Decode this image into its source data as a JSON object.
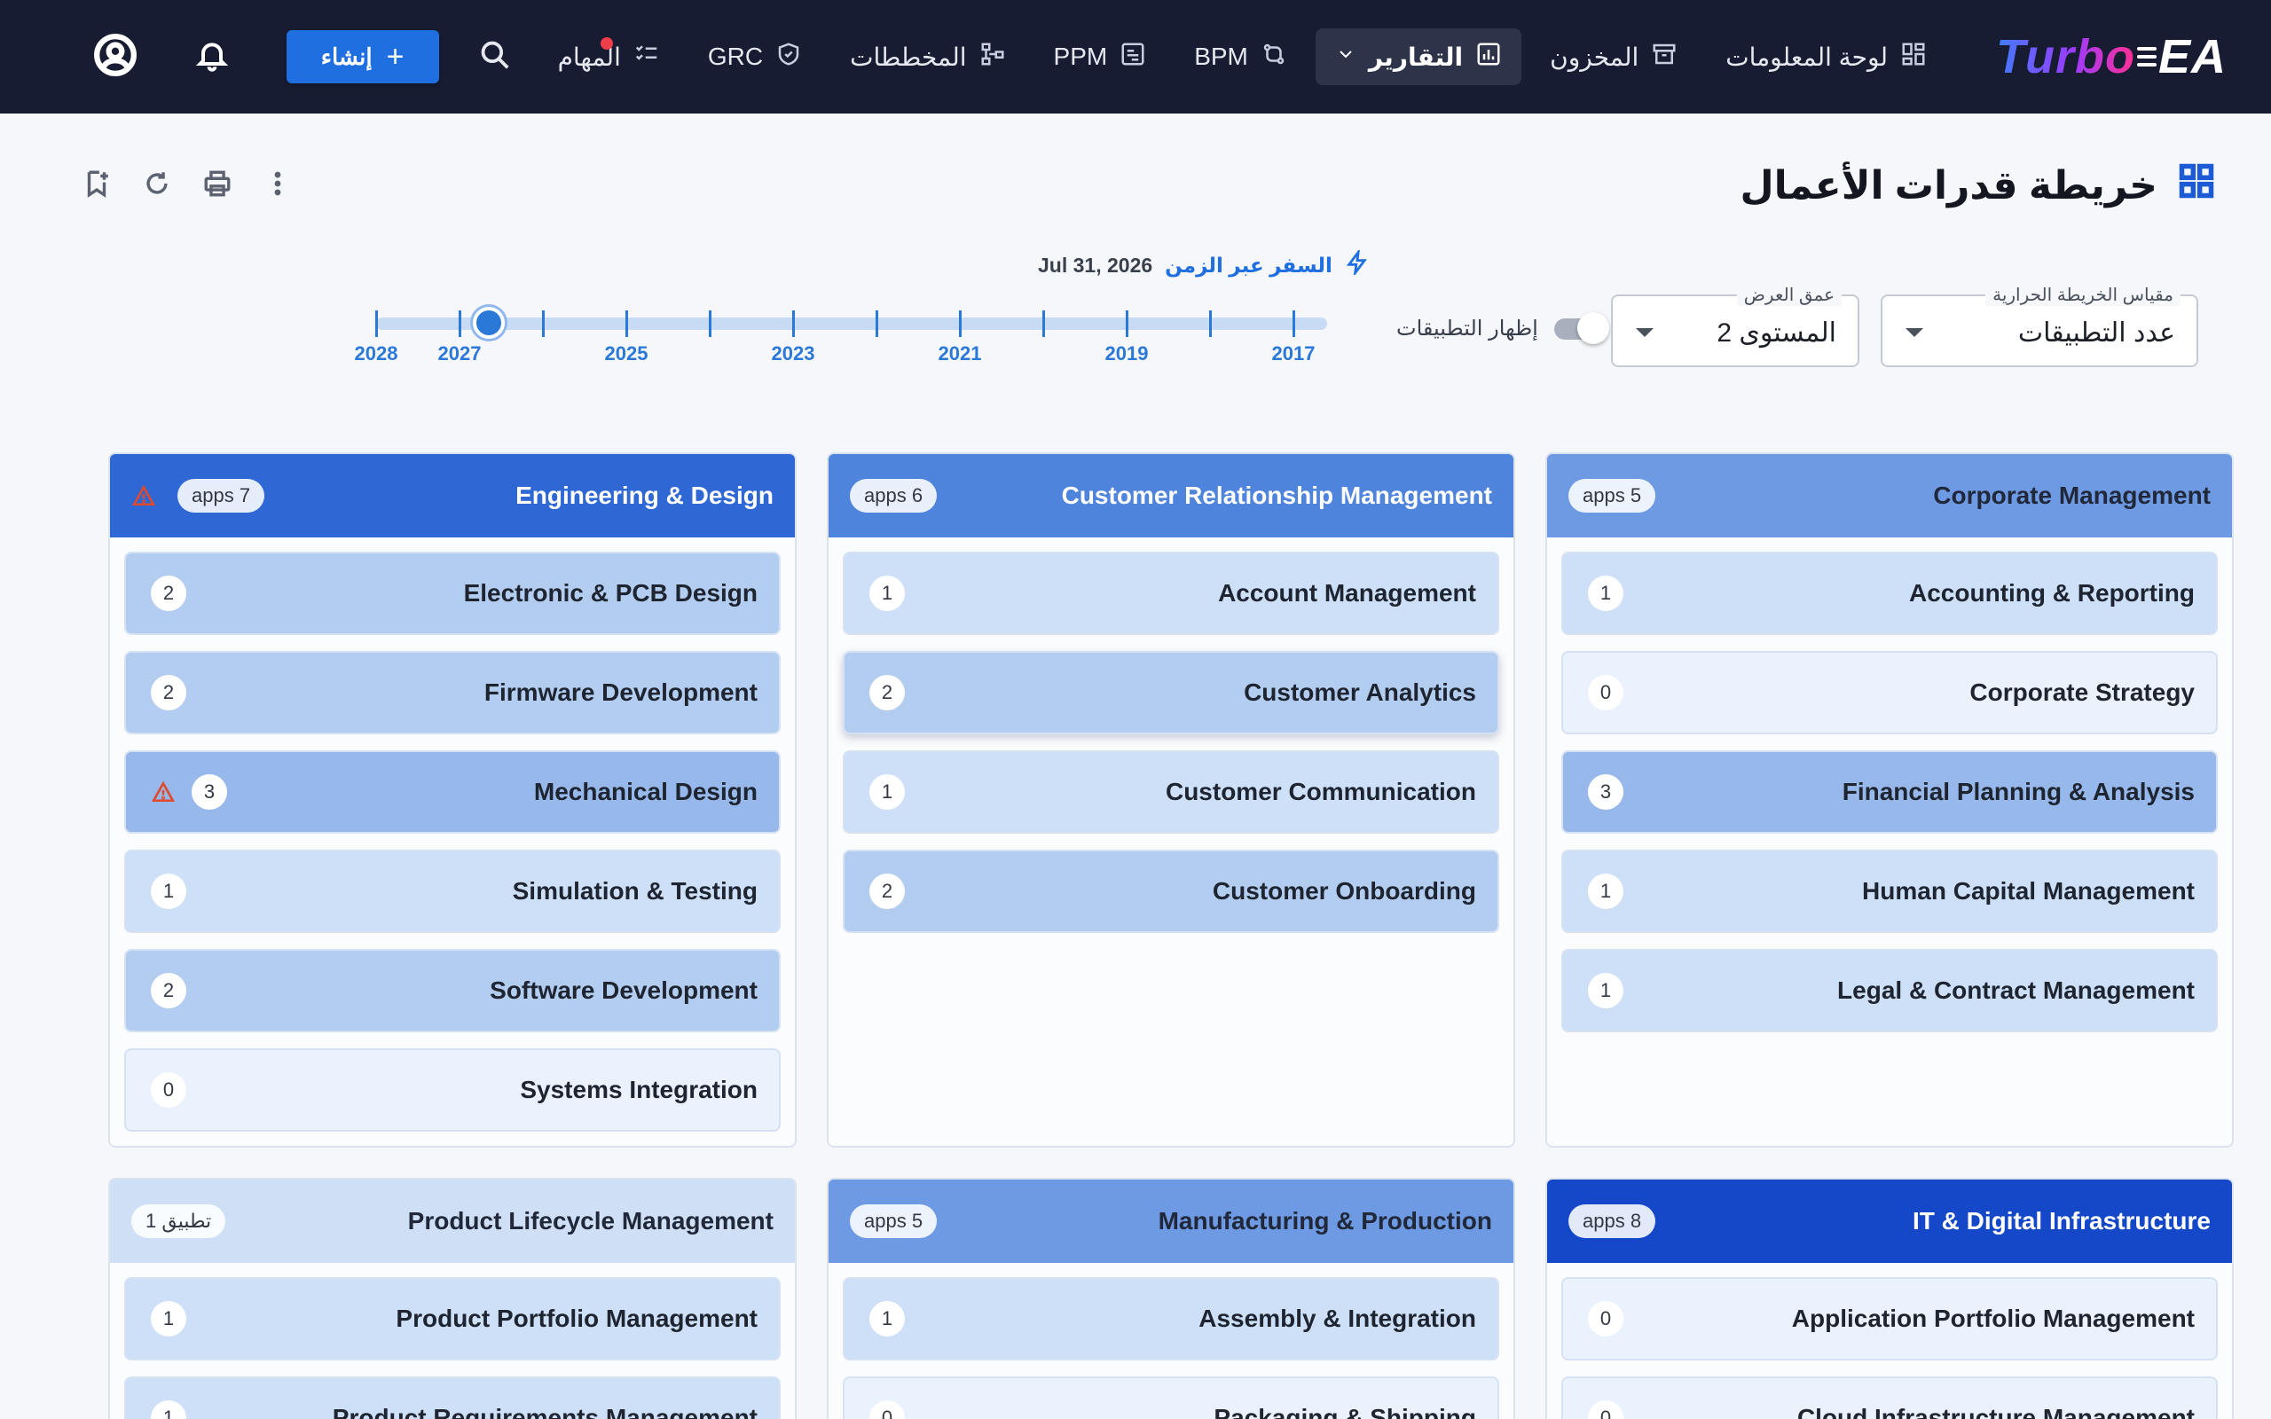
{
  "nav": {
    "logo_left": "Turbo",
    "logo_right": "EA",
    "items": [
      {
        "label": "لوحة المعلومات",
        "icon": "dashboard-icon"
      },
      {
        "label": "المخزون",
        "icon": "archive-icon"
      },
      {
        "label": "التقارير",
        "icon": "chart-icon",
        "active": true
      },
      {
        "label": "BPM",
        "icon": "flow-icon"
      },
      {
        "label": "PPM",
        "icon": "project-icon"
      },
      {
        "label": "المخططات",
        "icon": "diagram-icon"
      },
      {
        "label": "GRC",
        "icon": "shield-icon"
      },
      {
        "label": "المهام",
        "icon": "checklist-icon"
      }
    ],
    "create_label": "إنشاء"
  },
  "page": {
    "title": "خريطة قدرات الأعمال"
  },
  "controls": {
    "time_travel_label": "السفر عبر الزمن",
    "time_travel_date": "Jul 31, 2026",
    "timeline_years": [
      "2028",
      "2027",
      "2025",
      "2023",
      "2021",
      "2019",
      "2017"
    ],
    "timeline_position": 0.123,
    "toggle_label": "إظهار التطبيقات",
    "toggle_on": false,
    "heatmap_label": "مقياس الخريطة الحرارية",
    "heatmap_value": "عدد التطبيقات",
    "depth_label": "عمق العرض",
    "depth_value": "المستوى 2"
  },
  "colors": {
    "level0": "#eaf2fd",
    "level1": "#cde0f8",
    "level2": "#b3cdf1",
    "level3": "#97b8ea",
    "head_light": "#cfe0f6",
    "head_mid": "#6d9ae3",
    "head_strong": "#2f68d5",
    "head_deep": "#1448c8"
  },
  "cards": [
    {
      "title": "Corporate Management",
      "apps": "apps 5",
      "head_color": "#6d9ae3",
      "dark_title": true,
      "warning": false,
      "items": [
        {
          "label": "Accounting & Reporting",
          "count": "1",
          "level": 1
        },
        {
          "label": "Corporate Strategy",
          "count": "0",
          "level": 0
        },
        {
          "label": "Financial Planning & Analysis",
          "count": "3",
          "level": 3
        },
        {
          "label": "Human Capital Management",
          "count": "1",
          "level": 1
        },
        {
          "label": "Legal & Contract Management",
          "count": "1",
          "level": 1
        }
      ]
    },
    {
      "title": "Customer Relationship Management",
      "apps": "apps 6",
      "head_color": "#4f84dd",
      "dark_title": false,
      "warning": false,
      "items": [
        {
          "label": "Account Management",
          "count": "1",
          "level": 1
        },
        {
          "label": "Customer Analytics",
          "count": "2",
          "level": 2,
          "raised": true
        },
        {
          "label": "Customer Communication",
          "count": "1",
          "level": 1
        },
        {
          "label": "Customer Onboarding",
          "count": "2",
          "level": 2
        }
      ]
    },
    {
      "title": "Engineering & Design",
      "apps": "apps 7",
      "head_color": "#2f68d5",
      "dark_title": false,
      "warning": true,
      "items": [
        {
          "label": "Electronic & PCB Design",
          "count": "2",
          "level": 2
        },
        {
          "label": "Firmware Development",
          "count": "2",
          "level": 2
        },
        {
          "label": "Mechanical Design",
          "count": "3",
          "level": 3,
          "warning": true
        },
        {
          "label": "Simulation & Testing",
          "count": "1",
          "level": 1
        },
        {
          "label": "Software Development",
          "count": "2",
          "level": 2
        },
        {
          "label": "Systems Integration",
          "count": "0",
          "level": 0
        }
      ]
    },
    {
      "title": "IT & Digital Infrastructure",
      "apps": "apps 8",
      "head_color": "#1448c8",
      "dark_title": false,
      "warning": false,
      "items": [
        {
          "label": "Application Portfolio Management",
          "count": "0",
          "level": 0
        },
        {
          "label": "Cloud Infrastructure Management",
          "count": "0",
          "level": 0
        }
      ]
    },
    {
      "title": "Manufacturing & Production",
      "apps": "apps 5",
      "head_color": "#6d9ae3",
      "dark_title": true,
      "warning": false,
      "items": [
        {
          "label": "Assembly & Integration",
          "count": "1",
          "level": 1
        },
        {
          "label": "Packaging & Shipping",
          "count": "0",
          "level": 0
        }
      ]
    },
    {
      "title": "Product Lifecycle Management",
      "apps": "تطبيق 1",
      "head_color": "#cfe0f6",
      "dark_title": true,
      "warning": false,
      "items": [
        {
          "label": "Product Portfolio Management",
          "count": "1",
          "level": 1
        },
        {
          "label": "Product Requirements Management",
          "count": "1",
          "level": 1
        }
      ]
    }
  ]
}
